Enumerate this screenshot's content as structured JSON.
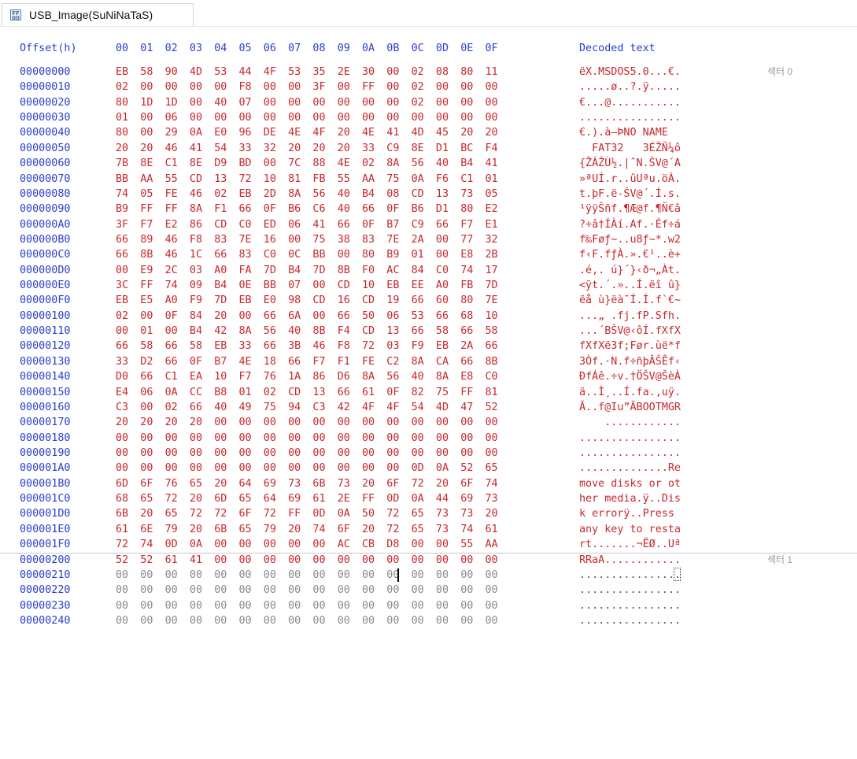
{
  "tab": {
    "title": "USB_Image(SuNiNaTaS)",
    "icon": "disk-image-icon"
  },
  "header": {
    "offset_label": "Offset(h)",
    "columns": [
      "00",
      "01",
      "02",
      "03",
      "04",
      "05",
      "06",
      "07",
      "08",
      "09",
      "0A",
      "0B",
      "0C",
      "0D",
      "0E",
      "0F"
    ],
    "decoded_label": "Decoded text"
  },
  "rows": [
    {
      "offset": "00000000",
      "bytes": [
        "EB",
        "58",
        "90",
        "4D",
        "53",
        "44",
        "4F",
        "53",
        "35",
        "2E",
        "30",
        "00",
        "02",
        "08",
        "80",
        "11"
      ],
      "text": "ëX.MSDOS5.0...€.",
      "sector": "섹터 0"
    },
    {
      "offset": "00000010",
      "bytes": [
        "02",
        "00",
        "00",
        "00",
        "00",
        "F8",
        "00",
        "00",
        "3F",
        "00",
        "FF",
        "00",
        "02",
        "00",
        "00",
        "00"
      ],
      "text": ".....ø..?.ÿ....."
    },
    {
      "offset": "00000020",
      "bytes": [
        "80",
        "1D",
        "1D",
        "00",
        "40",
        "07",
        "00",
        "00",
        "00",
        "00",
        "00",
        "00",
        "02",
        "00",
        "00",
        "00"
      ],
      "text": "€...@..........."
    },
    {
      "offset": "00000030",
      "bytes": [
        "01",
        "00",
        "06",
        "00",
        "00",
        "00",
        "00",
        "00",
        "00",
        "00",
        "00",
        "00",
        "00",
        "00",
        "00",
        "00"
      ],
      "text": "................"
    },
    {
      "offset": "00000040",
      "bytes": [
        "80",
        "00",
        "29",
        "0A",
        "E0",
        "96",
        "DE",
        "4E",
        "4F",
        "20",
        "4E",
        "41",
        "4D",
        "45",
        "20",
        "20"
      ],
      "text": "€.).à–ÞNO NAME  "
    },
    {
      "offset": "00000050",
      "bytes": [
        "20",
        "20",
        "46",
        "41",
        "54",
        "33",
        "32",
        "20",
        "20",
        "20",
        "33",
        "C9",
        "8E",
        "D1",
        "BC",
        "F4"
      ],
      "text": "  FAT32   3ÉŽÑ¼ô"
    },
    {
      "offset": "00000060",
      "bytes": [
        "7B",
        "8E",
        "C1",
        "8E",
        "D9",
        "BD",
        "00",
        "7C",
        "88",
        "4E",
        "02",
        "8A",
        "56",
        "40",
        "B4",
        "41"
      ],
      "text": "{ŽÁŽÙ½.|ˆN.ŠV@´A"
    },
    {
      "offset": "00000070",
      "bytes": [
        "BB",
        "AA",
        "55",
        "CD",
        "13",
        "72",
        "10",
        "81",
        "FB",
        "55",
        "AA",
        "75",
        "0A",
        "F6",
        "C1",
        "01"
      ],
      "text": "»ªUÍ.r..ûUªu.öÁ."
    },
    {
      "offset": "00000080",
      "bytes": [
        "74",
        "05",
        "FE",
        "46",
        "02",
        "EB",
        "2D",
        "8A",
        "56",
        "40",
        "B4",
        "08",
        "CD",
        "13",
        "73",
        "05"
      ],
      "text": "t.þF.ë-ŠV@´.Í.s."
    },
    {
      "offset": "00000090",
      "bytes": [
        "B9",
        "FF",
        "FF",
        "8A",
        "F1",
        "66",
        "0F",
        "B6",
        "C6",
        "40",
        "66",
        "0F",
        "B6",
        "D1",
        "80",
        "E2"
      ],
      "text": "¹ÿÿŠñf.¶Æ@f.¶Ñ€â"
    },
    {
      "offset": "000000A0",
      "bytes": [
        "3F",
        "F7",
        "E2",
        "86",
        "CD",
        "C0",
        "ED",
        "06",
        "41",
        "66",
        "0F",
        "B7",
        "C9",
        "66",
        "F7",
        "E1"
      ],
      "text": "?÷â†ÍÀí.Af.·Éf÷á"
    },
    {
      "offset": "000000B0",
      "bytes": [
        "66",
        "89",
        "46",
        "F8",
        "83",
        "7E",
        "16",
        "00",
        "75",
        "38",
        "83",
        "7E",
        "2A",
        "00",
        "77",
        "32"
      ],
      "text": "f‰Føƒ~..u8ƒ~*.w2"
    },
    {
      "offset": "000000C0",
      "bytes": [
        "66",
        "8B",
        "46",
        "1C",
        "66",
        "83",
        "C0",
        "0C",
        "BB",
        "00",
        "80",
        "B9",
        "01",
        "00",
        "E8",
        "2B"
      ],
      "text": "f‹F.fƒÀ.».€¹..è+"
    },
    {
      "offset": "000000D0",
      "bytes": [
        "00",
        "E9",
        "2C",
        "03",
        "A0",
        "FA",
        "7D",
        "B4",
        "7D",
        "8B",
        "F0",
        "AC",
        "84",
        "C0",
        "74",
        "17"
      ],
      "text": ".é,. ú}´}‹ð¬„Àt."
    },
    {
      "offset": "000000E0",
      "bytes": [
        "3C",
        "FF",
        "74",
        "09",
        "B4",
        "0E",
        "BB",
        "07",
        "00",
        "CD",
        "10",
        "EB",
        "EE",
        "A0",
        "FB",
        "7D"
      ],
      "text": "<ÿt.´.»..Í.ëî û}"
    },
    {
      "offset": "000000F0",
      "bytes": [
        "EB",
        "E5",
        "A0",
        "F9",
        "7D",
        "EB",
        "E0",
        "98",
        "CD",
        "16",
        "CD",
        "19",
        "66",
        "60",
        "80",
        "7E"
      ],
      "text": "ëå ù}ëà˜Í.Í.f`€~"
    },
    {
      "offset": "00000100",
      "bytes": [
        "02",
        "00",
        "0F",
        "84",
        "20",
        "00",
        "66",
        "6A",
        "00",
        "66",
        "50",
        "06",
        "53",
        "66",
        "68",
        "10"
      ],
      "text": "...„ .fj.fP.Sfh."
    },
    {
      "offset": "00000110",
      "bytes": [
        "00",
        "01",
        "00",
        "B4",
        "42",
        "8A",
        "56",
        "40",
        "8B",
        "F4",
        "CD",
        "13",
        "66",
        "58",
        "66",
        "58"
      ],
      "text": "...´BŠV@‹ôÍ.fXfX"
    },
    {
      "offset": "00000120",
      "bytes": [
        "66",
        "58",
        "66",
        "58",
        "EB",
        "33",
        "66",
        "3B",
        "46",
        "F8",
        "72",
        "03",
        "F9",
        "EB",
        "2A",
        "66"
      ],
      "text": "fXfXë3f;Før.ùë*f"
    },
    {
      "offset": "00000130",
      "bytes": [
        "33",
        "D2",
        "66",
        "0F",
        "B7",
        "4E",
        "18",
        "66",
        "F7",
        "F1",
        "FE",
        "C2",
        "8A",
        "CA",
        "66",
        "8B"
      ],
      "text": "3Òf.·N.f÷ñþÂŠÊf‹"
    },
    {
      "offset": "00000140",
      "bytes": [
        "D0",
        "66",
        "C1",
        "EA",
        "10",
        "F7",
        "76",
        "1A",
        "86",
        "D6",
        "8A",
        "56",
        "40",
        "8A",
        "E8",
        "C0"
      ],
      "text": "ÐfÁê.÷v.†ÖŠV@ŠèÀ"
    },
    {
      "offset": "00000150",
      "bytes": [
        "E4",
        "06",
        "0A",
        "CC",
        "B8",
        "01",
        "02",
        "CD",
        "13",
        "66",
        "61",
        "0F",
        "82",
        "75",
        "FF",
        "81"
      ],
      "text": "ä..Ì¸..Í.fa.‚uÿ."
    },
    {
      "offset": "00000160",
      "bytes": [
        "C3",
        "00",
        "02",
        "66",
        "40",
        "49",
        "75",
        "94",
        "C3",
        "42",
        "4F",
        "4F",
        "54",
        "4D",
        "47",
        "52"
      ],
      "text": "Ã..f@Iu”ÃBOOTMGR"
    },
    {
      "offset": "00000170",
      "bytes": [
        "20",
        "20",
        "20",
        "20",
        "00",
        "00",
        "00",
        "00",
        "00",
        "00",
        "00",
        "00",
        "00",
        "00",
        "00",
        "00"
      ],
      "text": "    ............"
    },
    {
      "offset": "00000180",
      "bytes": [
        "00",
        "00",
        "00",
        "00",
        "00",
        "00",
        "00",
        "00",
        "00",
        "00",
        "00",
        "00",
        "00",
        "00",
        "00",
        "00"
      ],
      "text": "................"
    },
    {
      "offset": "00000190",
      "bytes": [
        "00",
        "00",
        "00",
        "00",
        "00",
        "00",
        "00",
        "00",
        "00",
        "00",
        "00",
        "00",
        "00",
        "00",
        "00",
        "00"
      ],
      "text": "................"
    },
    {
      "offset": "000001A0",
      "bytes": [
        "00",
        "00",
        "00",
        "00",
        "00",
        "00",
        "00",
        "00",
        "00",
        "00",
        "00",
        "00",
        "0D",
        "0A",
        "52",
        "65"
      ],
      "text": "..............Re"
    },
    {
      "offset": "000001B0",
      "bytes": [
        "6D",
        "6F",
        "76",
        "65",
        "20",
        "64",
        "69",
        "73",
        "6B",
        "73",
        "20",
        "6F",
        "72",
        "20",
        "6F",
        "74"
      ],
      "text": "move disks or ot"
    },
    {
      "offset": "000001C0",
      "bytes": [
        "68",
        "65",
        "72",
        "20",
        "6D",
        "65",
        "64",
        "69",
        "61",
        "2E",
        "FF",
        "0D",
        "0A",
        "44",
        "69",
        "73"
      ],
      "text": "her media.ÿ..Dis"
    },
    {
      "offset": "000001D0",
      "bytes": [
        "6B",
        "20",
        "65",
        "72",
        "72",
        "6F",
        "72",
        "FF",
        "0D",
        "0A",
        "50",
        "72",
        "65",
        "73",
        "73",
        "20"
      ],
      "text": "k errorÿ..Press "
    },
    {
      "offset": "000001E0",
      "bytes": [
        "61",
        "6E",
        "79",
        "20",
        "6B",
        "65",
        "79",
        "20",
        "74",
        "6F",
        "20",
        "72",
        "65",
        "73",
        "74",
        "61"
      ],
      "text": "any key to resta"
    },
    {
      "offset": "000001F0",
      "bytes": [
        "72",
        "74",
        "0D",
        "0A",
        "00",
        "00",
        "00",
        "00",
        "00",
        "AC",
        "CB",
        "D8",
        "00",
        "00",
        "55",
        "AA"
      ],
      "text": "rt.......¬ËØ..Uª"
    },
    {
      "offset": "00000200",
      "bytes": [
        "52",
        "52",
        "61",
        "41",
        "00",
        "00",
        "00",
        "00",
        "00",
        "00",
        "00",
        "00",
        "00",
        "00",
        "00",
        "00"
      ],
      "text": "RRaA............",
      "sector": "섹터 1"
    },
    {
      "offset": "00000210",
      "bytes": [
        "00",
        "00",
        "00",
        "00",
        "00",
        "00",
        "00",
        "00",
        "00",
        "00",
        "00",
        "00",
        "00",
        "00",
        "00",
        "00"
      ],
      "text": "................"
    },
    {
      "offset": "00000220",
      "bytes": [
        "00",
        "00",
        "00",
        "00",
        "00",
        "00",
        "00",
        "00",
        "00",
        "00",
        "00",
        "00",
        "00",
        "00",
        "00",
        "00"
      ],
      "text": "................"
    },
    {
      "offset": "00000230",
      "bytes": [
        "00",
        "00",
        "00",
        "00",
        "00",
        "00",
        "00",
        "00",
        "00",
        "00",
        "00",
        "00",
        "00",
        "00",
        "00",
        "00"
      ],
      "text": "................"
    },
    {
      "offset": "00000240",
      "bytes": [
        "00",
        "00",
        "00",
        "00",
        "00",
        "00",
        "00",
        "00",
        "00",
        "00",
        "00",
        "00",
        "00",
        "00",
        "00",
        "00"
      ],
      "text": "................"
    }
  ],
  "colors": {
    "offset": "#2a3fd0",
    "modified_byte": "#c7282d",
    "zero_byte": "#8a8a8a"
  }
}
